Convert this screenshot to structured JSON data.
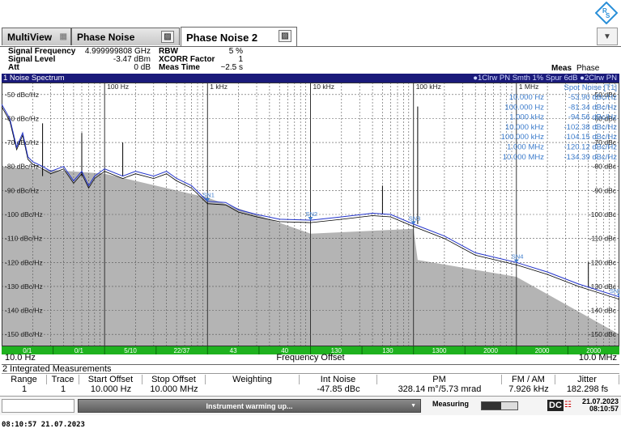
{
  "tabs": [
    {
      "label": "MultiView"
    },
    {
      "label": "Phase Noise"
    },
    {
      "label": "Phase Noise 2"
    }
  ],
  "info": {
    "signal_frequency_label": "Signal Frequency",
    "signal_frequency_value": "4.999999808 GHz",
    "signal_level_label": "Signal Level",
    "signal_level_value": "-3.47 dBm",
    "att_label": "Att",
    "att_value": "0 dB",
    "rbw_label": "RBW",
    "rbw_value": "5 %",
    "xcorr_label": "XCORR Factor",
    "xcorr_value": "1",
    "meas_time_label": "Meas Time",
    "meas_time_value": "~2.5 s",
    "meas_label": "Meas",
    "meas_value": "Phase Noise"
  },
  "diagram": {
    "title": "1 Noise Spectrum",
    "trace_info": "●1Clrw PN Smth 1% Spur 6dB  ●2Clrw PN",
    "spot_noise_title": "Spot Noise [T1]",
    "spot_noise": [
      {
        "offset": "10.000 Hz",
        "value": "-53.90 dBc/Hz"
      },
      {
        "offset": "100.000 Hz",
        "value": "-81.34 dBc/Hz"
      },
      {
        "offset": "1.000 kHz",
        "value": "-94.56 dBc/Hz"
      },
      {
        "offset": "10.000 kHz",
        "value": "-102.38 dBc/Hz"
      },
      {
        "offset": "100.000 kHz",
        "value": "-104.15 dBc/Hz"
      },
      {
        "offset": "1.000 MHz",
        "value": "-120.12 dBc/Hz"
      },
      {
        "offset": "10.000 MHz",
        "value": "-134.39 dBc/Hz"
      }
    ],
    "x_start": "10.0 Hz",
    "x_stop": "10.0 MHz",
    "x_title": "Frequency Offset",
    "decade_labels": [
      "100 Hz",
      "1 kHz",
      "10 kHz",
      "100 kHz",
      "1 MHz"
    ],
    "y_labels_left": [
      "-50 dBc/Hz",
      "-60 dBc/Hz",
      "-70 dBc/Hz",
      "-80 dBc/Hz",
      "-90 dBc/Hz",
      "-100 dBc/Hz",
      "-110 dBc/Hz",
      "-120 dBc/Hz",
      "-130 dBc/Hz",
      "-140 dBc/Hz",
      "-150 dBc/Hz"
    ],
    "y_labels_right": [
      "-50 dBc",
      "-60 dBc",
      "-70 dBc",
      "-80 dBc",
      "-90 dBc",
      "-100 dBc",
      "-110 dBc",
      "-120 dBc",
      "-130 dBc",
      "-140 dBc",
      "-150 dBc"
    ],
    "green_bar": [
      "0/1",
      "0/1",
      "5/10",
      "22/37",
      "43",
      "40",
      "130",
      "130",
      "1300",
      "2000",
      "2000",
      "2000"
    ],
    "markers": [
      "SN1",
      "SN2",
      "SN3",
      "SN4",
      "SN5"
    ]
  },
  "chart_data": {
    "type": "line",
    "x_scale": "log",
    "xlim": [
      10,
      10000000
    ],
    "ylim": [
      -155,
      -45
    ],
    "xlabel": "Frequency Offset",
    "series": [
      {
        "points": [
          [
            10,
            -54
          ],
          [
            12,
            -60
          ],
          [
            14,
            -72
          ],
          [
            16,
            -66
          ],
          [
            18,
            -76
          ],
          [
            20,
            -78
          ],
          [
            25,
            -80
          ],
          [
            30,
            -82
          ],
          [
            40,
            -80
          ],
          [
            50,
            -86
          ],
          [
            60,
            -82
          ],
          [
            70,
            -88
          ],
          [
            80,
            -84
          ],
          [
            100,
            -81
          ],
          [
            150,
            -84
          ],
          [
            200,
            -82
          ],
          [
            300,
            -84
          ],
          [
            400,
            -82
          ],
          [
            500,
            -85
          ],
          [
            700,
            -88
          ],
          [
            1000,
            -94.5
          ],
          [
            1500,
            -95
          ],
          [
            2000,
            -98
          ],
          [
            3000,
            -100
          ],
          [
            5000,
            -102
          ],
          [
            10000,
            -102.4
          ],
          [
            20000,
            -101
          ],
          [
            40000,
            -99.5
          ],
          [
            60000,
            -100
          ],
          [
            100000,
            -104
          ],
          [
            200000,
            -109
          ],
          [
            400000,
            -116
          ],
          [
            1000000,
            -120
          ],
          [
            2000000,
            -124
          ],
          [
            4000000,
            -129
          ],
          [
            10000000,
            -134.4
          ]
        ]
      },
      {
        "points": [
          [
            10,
            -80
          ],
          [
            100,
            -83
          ],
          [
            1000,
            -93
          ],
          [
            10000,
            -108
          ],
          [
            100000,
            -106
          ],
          [
            110000,
            -119
          ],
          [
            1000000,
            -126
          ],
          [
            10000000,
            -150
          ]
        ]
      }
    ]
  },
  "integrated": {
    "title": "2 Integrated Measurements",
    "headers": [
      "Range",
      "Trace",
      "Start Offset",
      "Stop Offset",
      "Weighting",
      "Int Noise",
      "PM",
      "FM / AM",
      "Jitter"
    ],
    "row": [
      "1",
      "1",
      "10.000 Hz",
      "10.000 MHz",
      "",
      "-47.85 dBc",
      "328.14 m°/5.73 mrad",
      "7.926 kHz",
      "182.298 fs"
    ]
  },
  "status": {
    "message": "Instrument warming up...",
    "measuring": "Measuring",
    "dc": "DC",
    "date": "21.07.2023",
    "time": "08:10:57"
  },
  "footer_timestamp": "08:10:57  21.07.2023",
  "colors": {
    "trace1": "#2233cc",
    "trace2": "#000000",
    "noise_floor": "#b4b4b4",
    "diag_bar": "#1a1a7a",
    "spot_text": "#3a7acb",
    "green_bar": "#1fb21f"
  }
}
